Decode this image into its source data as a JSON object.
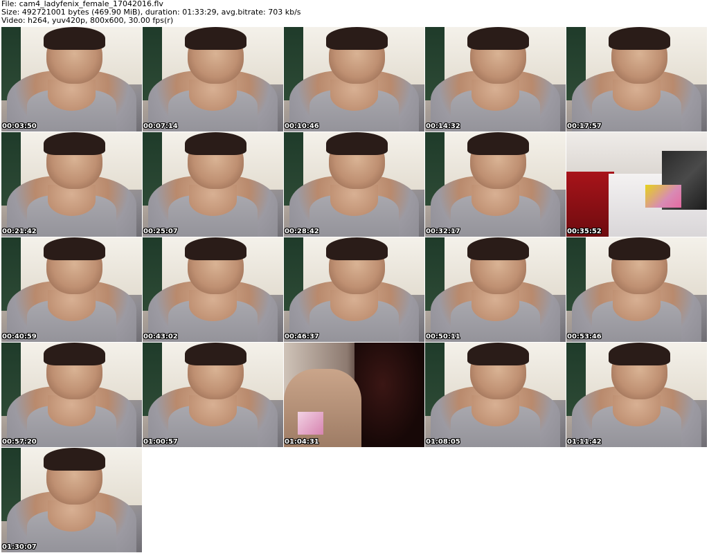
{
  "header": {
    "file_line": "File: cam4_ladyfenix_female_17042016.flv",
    "size_line": "Size: 492721001 bytes (469.90 MiB), duration: 01:33:29, avg.bitrate: 703 kb/s",
    "video_line": "Video: h264, yuv420p, 800x600, 30.00 fps(r)"
  },
  "thumbnails": [
    {
      "timestamp": "00:03:50",
      "scene": "person"
    },
    {
      "timestamp": "00:07:14",
      "scene": "person"
    },
    {
      "timestamp": "00:10:46",
      "scene": "person"
    },
    {
      "timestamp": "00:14:32",
      "scene": "person"
    },
    {
      "timestamp": "00:17:57",
      "scene": "person"
    },
    {
      "timestamp": "00:21:42",
      "scene": "person"
    },
    {
      "timestamp": "00:25:07",
      "scene": "person"
    },
    {
      "timestamp": "00:28:42",
      "scene": "person"
    },
    {
      "timestamp": "00:32:17",
      "scene": "person"
    },
    {
      "timestamp": "00:35:52",
      "scene": "bedroom"
    },
    {
      "timestamp": "00:40:59",
      "scene": "person"
    },
    {
      "timestamp": "00:43:02",
      "scene": "person"
    },
    {
      "timestamp": "00:46:37",
      "scene": "person"
    },
    {
      "timestamp": "00:50:11",
      "scene": "person"
    },
    {
      "timestamp": "00:53:46",
      "scene": "person"
    },
    {
      "timestamp": "00:57:20",
      "scene": "person"
    },
    {
      "timestamp": "01:00:57",
      "scene": "person"
    },
    {
      "timestamp": "01:04:31",
      "scene": "dark"
    },
    {
      "timestamp": "01:08:05",
      "scene": "person"
    },
    {
      "timestamp": "01:11:42",
      "scene": "person"
    },
    {
      "timestamp": "01:30:07",
      "scene": "person"
    }
  ]
}
